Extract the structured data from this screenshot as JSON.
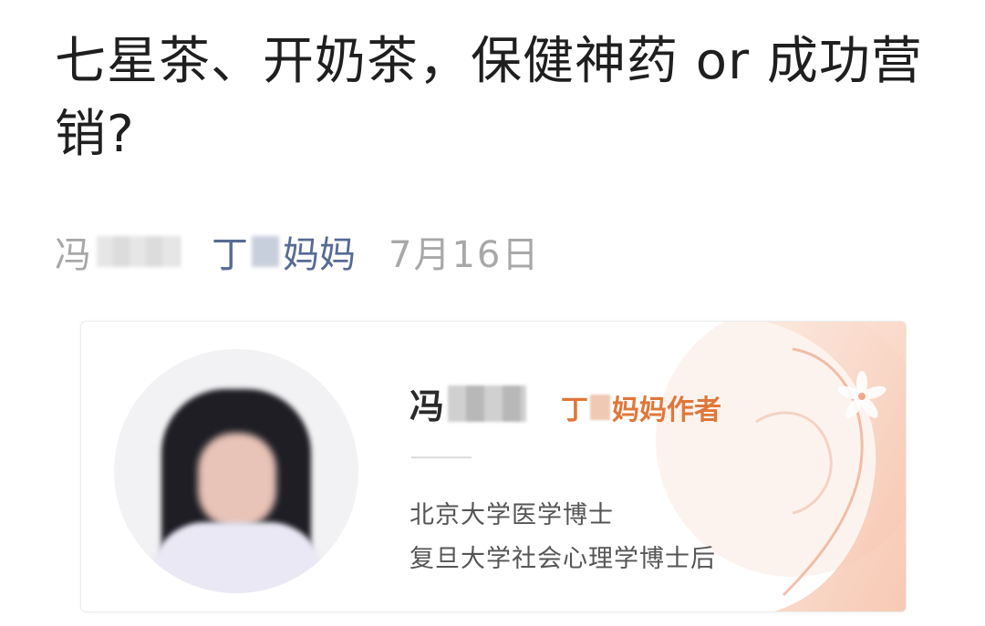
{
  "article": {
    "title": "七星茶、开奶茶，保健神药 or 成功营销?"
  },
  "meta": {
    "author_prefix": "冯",
    "account_first": "丁",
    "account_last": "妈妈",
    "date": "7月16日"
  },
  "author_card": {
    "name_prefix": "冯",
    "role_first": "丁",
    "role_last": "妈妈作者",
    "credentials": [
      "北京大学医学博士",
      "复旦大学社会心理学博士后"
    ],
    "accent_color": "#e0773a"
  },
  "colors": {
    "link": "#576b95",
    "muted": "#a8a8a8"
  }
}
